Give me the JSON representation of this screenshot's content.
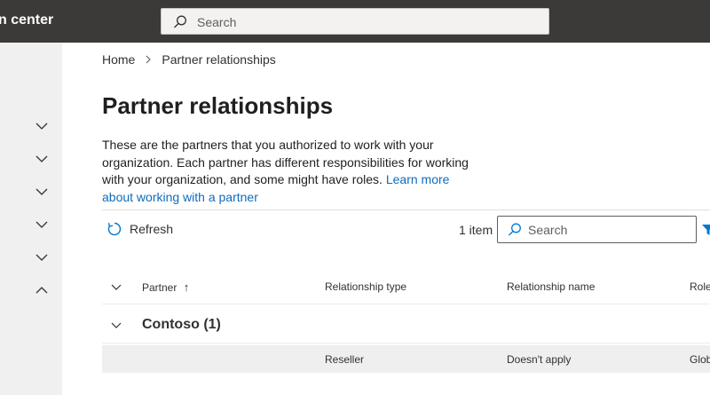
{
  "app": {
    "title": "n center"
  },
  "top_search": {
    "placeholder": "Search"
  },
  "left_nav": {
    "chevrons": [
      "chevron-down",
      "chevron-down",
      "chevron-down",
      "chevron-down",
      "chevron-down",
      "chevron-up"
    ]
  },
  "breadcrumb": {
    "home": "Home",
    "current": "Partner relationships"
  },
  "page": {
    "title": "Partner relationships",
    "description": "These are the partners that you authorized to work with your organization. Each partner has different responsibilities for working with your organization, and some might have roles.",
    "learn_more": "Learn more about working with a partner"
  },
  "commands": {
    "refresh": "Refresh",
    "item_count": "1 item",
    "search_placeholder": "Search"
  },
  "table": {
    "columns": {
      "partner": "Partner",
      "sort_indicator": "↑",
      "relationship_type": "Relationship type",
      "relationship_name": "Relationship name",
      "roles": "Roles"
    },
    "group": {
      "label": "Contoso (1)"
    },
    "rows": [
      {
        "partner": "",
        "relationship_type": "Reseller",
        "relationship_name": "Doesn't apply",
        "roles": "Global"
      }
    ]
  },
  "colors": {
    "topbar": "#3b3a39",
    "link": "#0f6cbd",
    "filter": "#0078d4"
  }
}
